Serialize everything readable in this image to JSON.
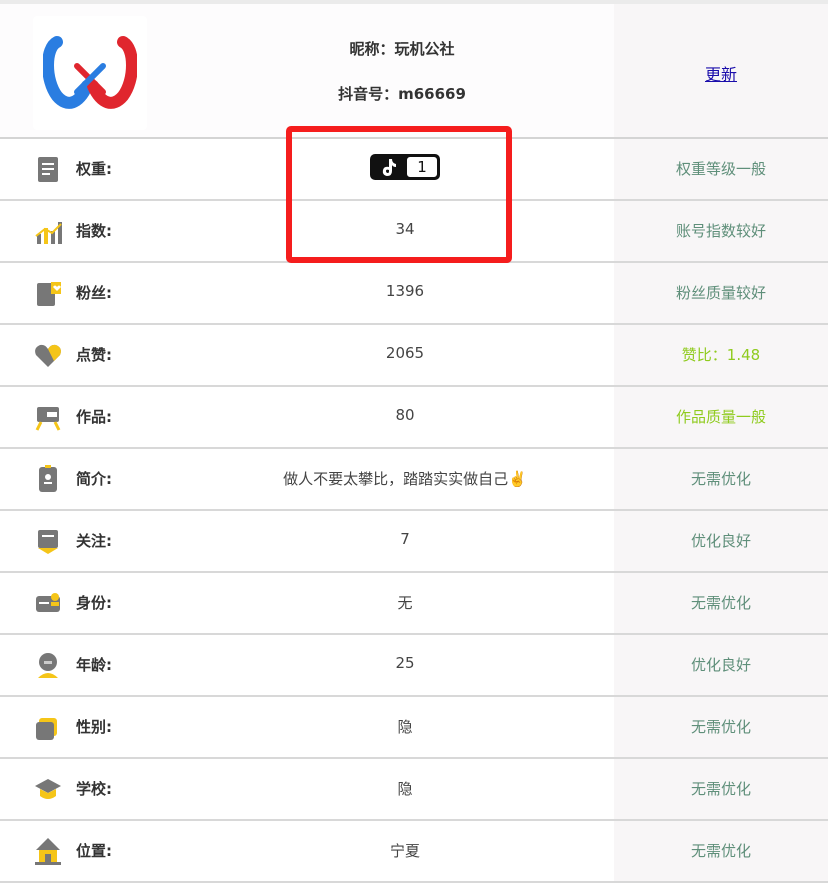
{
  "header": {
    "nickname": "昵称：玩机公社",
    "douyin_id": "抖音号：m66669",
    "update_link": "更新"
  },
  "rows": [
    {
      "label": "权重:",
      "value": "1",
      "status": "权重等级一般",
      "icon": "document-icon"
    },
    {
      "label": "指数:",
      "value": "34",
      "status": "账号指数较好",
      "icon": "chart-icon"
    },
    {
      "label": "粉丝:",
      "value": "1396",
      "status": "粉丝质量较好",
      "icon": "fans-icon"
    },
    {
      "label": "点赞:",
      "value": "2065",
      "status": "赞比：1.48",
      "icon": "heart-icon"
    },
    {
      "label": "作品:",
      "value": "80",
      "status": "作品质量一般",
      "icon": "camera-icon"
    },
    {
      "label": "简介:",
      "value": "做人不要太攀比，踏踏实实做自己✌️",
      "status": "无需优化",
      "icon": "profile-icon"
    },
    {
      "label": "关注:",
      "value": "7",
      "status": "优化良好",
      "icon": "follow-icon"
    },
    {
      "label": "身份:",
      "value": "无",
      "status": "无需优化",
      "icon": "id-card-icon"
    },
    {
      "label": "年龄:",
      "value": "25",
      "status": "优化良好",
      "icon": "avatar-icon"
    },
    {
      "label": "性别:",
      "value": "隐",
      "status": "无需优化",
      "icon": "gender-icon"
    },
    {
      "label": "学校:",
      "value": "隐",
      "status": "无需优化",
      "icon": "graduation-cap-icon"
    },
    {
      "label": "位置:",
      "value": "宁夏",
      "status": "无需优化",
      "icon": "location-house-icon"
    }
  ],
  "colors": {
    "status_green": "#5f8f7a",
    "status_lime": "#8fcb1e",
    "highlight_red": "#f51d1d",
    "icon_gray": "#777777",
    "icon_yellow": "#f5c518"
  }
}
